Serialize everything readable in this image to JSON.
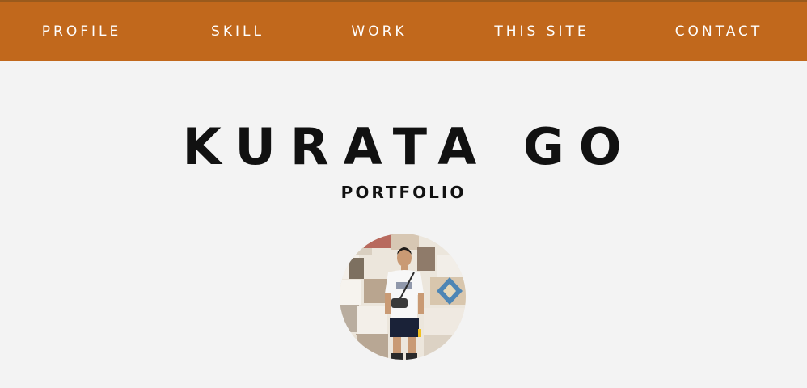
{
  "nav": {
    "background": "#c1681c",
    "items": [
      {
        "label": "PROFILE"
      },
      {
        "label": "SKILL"
      },
      {
        "label": "WORK"
      },
      {
        "label": "THIS SITE"
      },
      {
        "label": "CONTACT"
      }
    ]
  },
  "hero": {
    "name": "KURATA GO",
    "subtitle": "PORTFOLIO",
    "avatar_icon": "profile-photo"
  }
}
